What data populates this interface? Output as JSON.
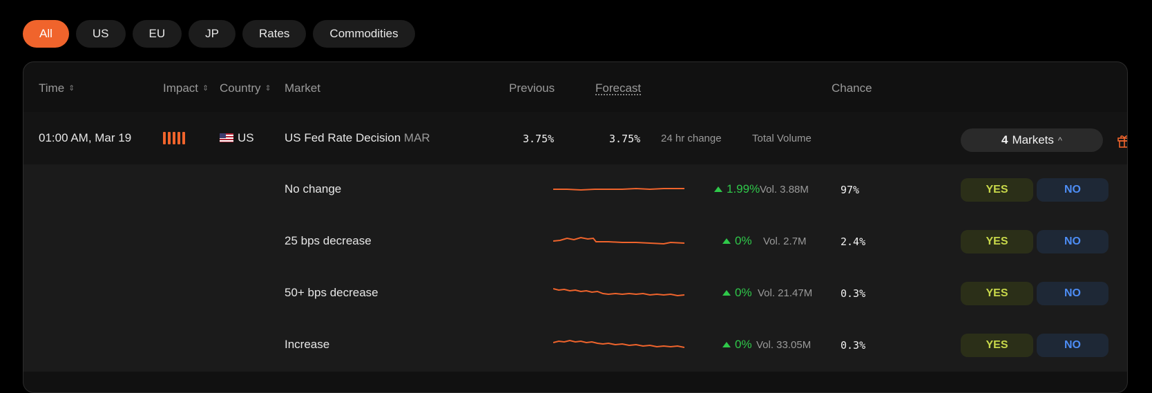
{
  "filters": [
    {
      "label": "All",
      "active": true
    },
    {
      "label": "US",
      "active": false
    },
    {
      "label": "EU",
      "active": false
    },
    {
      "label": "JP",
      "active": false
    },
    {
      "label": "Rates",
      "active": false
    },
    {
      "label": "Commodities",
      "active": false
    }
  ],
  "columns": {
    "time": "Time",
    "impact": "Impact",
    "country": "Country",
    "market": "Market",
    "previous": "Previous",
    "forecast": "Forecast",
    "chance": "Chance"
  },
  "event": {
    "time": "01:00 AM, Mar 19",
    "impact_bars": 5,
    "country": "US",
    "market": "US Fed Rate Decision",
    "market_tag": "MAR",
    "previous": "3.75%",
    "forecast": "3.75%",
    "change_label": "24 hr change",
    "volume_label": "Total Volume",
    "markets_count": "4",
    "markets_label": "Markets",
    "markets_chevron": "^"
  },
  "outcomes": [
    {
      "name": "No change",
      "change": "1.99%",
      "volume": "Vol. 3.88M",
      "chance": "97%",
      "yes": "YES",
      "no": "NO"
    },
    {
      "name": "25 bps decrease",
      "change": "0%",
      "volume": "Vol. 2.7M",
      "chance": "2.4%",
      "yes": "YES",
      "no": "NO"
    },
    {
      "name": "50+ bps decrease",
      "change": "0%",
      "volume": "Vol. 21.47M",
      "chance": "0.3%",
      "yes": "YES",
      "no": "NO"
    },
    {
      "name": "Increase",
      "change": "0%",
      "volume": "Vol. 33.05M",
      "chance": "0.3%",
      "yes": "YES",
      "no": "NO"
    }
  ],
  "colors": {
    "accent": "#f0642c",
    "positive": "#2fc84a",
    "yes_text": "#c8d84a",
    "no_text": "#4d8df5"
  }
}
